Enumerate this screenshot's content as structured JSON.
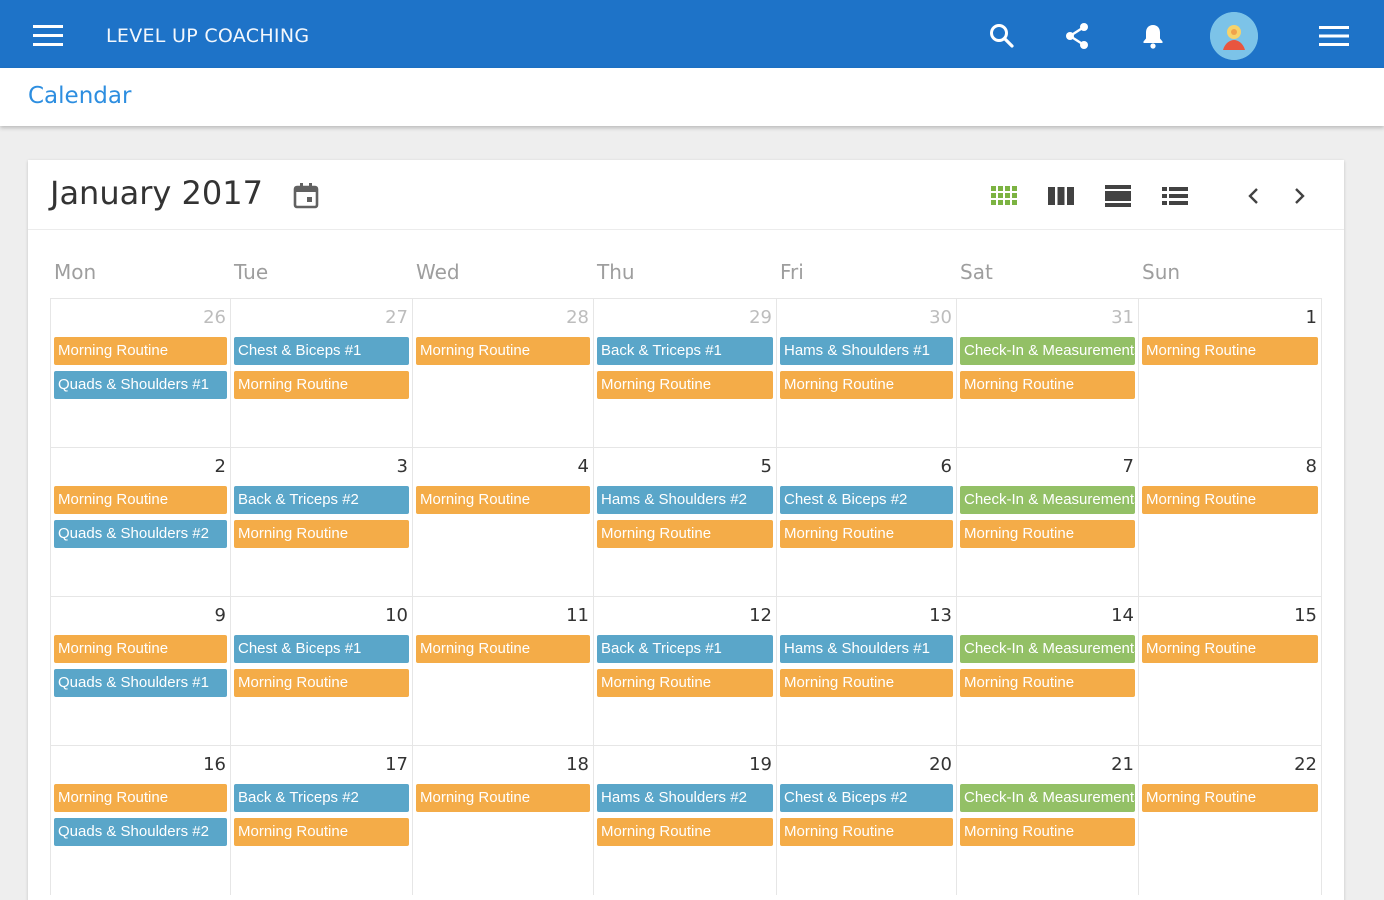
{
  "app": {
    "title": "LEVEL UP COACHING",
    "icons": [
      "menu-icon",
      "search-icon",
      "share-icon",
      "bell-icon",
      "avatar",
      "menu-icon"
    ]
  },
  "breadcrumb": {
    "label": "Calendar"
  },
  "calendar": {
    "month_title": "January 2017",
    "weekdays": [
      "Mon",
      "Tue",
      "Wed",
      "Thu",
      "Fri",
      "Sat",
      "Sun"
    ],
    "colors": {
      "routine": "#f4ac48",
      "workout": "#5aa6c9",
      "checkin": "#93c066",
      "accent": "#1e73c8",
      "active_view": "#7cb342"
    },
    "views": [
      "month-view-icon",
      "week-view-icon",
      "day-view-icon",
      "list-view-icon"
    ],
    "weeks": [
      {
        "days": [
          {
            "num": "26",
            "other": true,
            "events": [
              {
                "label": "Morning Routine",
                "type": "routine"
              },
              {
                "label": "Quads & Shoulders #1",
                "type": "workout"
              }
            ]
          },
          {
            "num": "27",
            "other": true,
            "events": [
              {
                "label": "Chest & Biceps #1",
                "type": "workout"
              },
              {
                "label": "Morning Routine",
                "type": "routine"
              }
            ]
          },
          {
            "num": "28",
            "other": true,
            "events": [
              {
                "label": "Morning Routine",
                "type": "routine"
              }
            ]
          },
          {
            "num": "29",
            "other": true,
            "events": [
              {
                "label": "Back & Triceps #1",
                "type": "workout"
              },
              {
                "label": "Morning Routine",
                "type": "routine"
              }
            ]
          },
          {
            "num": "30",
            "other": true,
            "events": [
              {
                "label": "Hams & Shoulders #1",
                "type": "workout"
              },
              {
                "label": "Morning Routine",
                "type": "routine"
              }
            ]
          },
          {
            "num": "31",
            "other": true,
            "events": [
              {
                "label": "Check-In & Measurements",
                "type": "checkin"
              },
              {
                "label": "Morning Routine",
                "type": "routine"
              }
            ]
          },
          {
            "num": "1",
            "other": false,
            "events": [
              {
                "label": "Morning Routine",
                "type": "routine"
              }
            ]
          }
        ]
      },
      {
        "days": [
          {
            "num": "2",
            "other": false,
            "events": [
              {
                "label": "Morning Routine",
                "type": "routine"
              },
              {
                "label": "Quads & Shoulders #2",
                "type": "workout"
              }
            ]
          },
          {
            "num": "3",
            "other": false,
            "events": [
              {
                "label": "Back & Triceps #2",
                "type": "workout"
              },
              {
                "label": "Morning Routine",
                "type": "routine"
              }
            ]
          },
          {
            "num": "4",
            "other": false,
            "events": [
              {
                "label": "Morning Routine",
                "type": "routine"
              }
            ]
          },
          {
            "num": "5",
            "other": false,
            "events": [
              {
                "label": "Hams & Shoulders #2",
                "type": "workout"
              },
              {
                "label": "Morning Routine",
                "type": "routine"
              }
            ]
          },
          {
            "num": "6",
            "other": false,
            "events": [
              {
                "label": "Chest & Biceps #2",
                "type": "workout"
              },
              {
                "label": "Morning Routine",
                "type": "routine"
              }
            ]
          },
          {
            "num": "7",
            "other": false,
            "events": [
              {
                "label": "Check-In & Measurements",
                "type": "checkin"
              },
              {
                "label": "Morning Routine",
                "type": "routine"
              }
            ]
          },
          {
            "num": "8",
            "other": false,
            "events": [
              {
                "label": "Morning Routine",
                "type": "routine"
              }
            ]
          }
        ]
      },
      {
        "days": [
          {
            "num": "9",
            "other": false,
            "events": [
              {
                "label": "Morning Routine",
                "type": "routine"
              },
              {
                "label": "Quads & Shoulders #1",
                "type": "workout"
              }
            ]
          },
          {
            "num": "10",
            "other": false,
            "events": [
              {
                "label": "Chest & Biceps #1",
                "type": "workout"
              },
              {
                "label": "Morning Routine",
                "type": "routine"
              }
            ]
          },
          {
            "num": "11",
            "other": false,
            "events": [
              {
                "label": "Morning Routine",
                "type": "routine"
              }
            ]
          },
          {
            "num": "12",
            "other": false,
            "events": [
              {
                "label": "Back & Triceps #1",
                "type": "workout"
              },
              {
                "label": "Morning Routine",
                "type": "routine"
              }
            ]
          },
          {
            "num": "13",
            "other": false,
            "events": [
              {
                "label": "Hams & Shoulders #1",
                "type": "workout"
              },
              {
                "label": "Morning Routine",
                "type": "routine"
              }
            ]
          },
          {
            "num": "14",
            "other": false,
            "events": [
              {
                "label": "Check-In & Measurements",
                "type": "checkin"
              },
              {
                "label": "Morning Routine",
                "type": "routine"
              }
            ]
          },
          {
            "num": "15",
            "other": false,
            "events": [
              {
                "label": "Morning Routine",
                "type": "routine"
              }
            ]
          }
        ]
      },
      {
        "days": [
          {
            "num": "16",
            "other": false,
            "events": [
              {
                "label": "Morning Routine",
                "type": "routine"
              },
              {
                "label": "Quads & Shoulders #2",
                "type": "workout"
              }
            ]
          },
          {
            "num": "17",
            "other": false,
            "events": [
              {
                "label": "Back & Triceps #2",
                "type": "workout"
              },
              {
                "label": "Morning Routine",
                "type": "routine"
              }
            ]
          },
          {
            "num": "18",
            "other": false,
            "events": [
              {
                "label": "Morning Routine",
                "type": "routine"
              }
            ]
          },
          {
            "num": "19",
            "other": false,
            "events": [
              {
                "label": "Hams & Shoulders #2",
                "type": "workout"
              },
              {
                "label": "Morning Routine",
                "type": "routine"
              }
            ]
          },
          {
            "num": "20",
            "other": false,
            "events": [
              {
                "label": "Chest & Biceps #2",
                "type": "workout"
              },
              {
                "label": "Morning Routine",
                "type": "routine"
              }
            ]
          },
          {
            "num": "21",
            "other": false,
            "events": [
              {
                "label": "Check-In & Measurements",
                "type": "checkin"
              },
              {
                "label": "Morning Routine",
                "type": "routine"
              }
            ]
          },
          {
            "num": "22",
            "other": false,
            "events": [
              {
                "label": "Morning Routine",
                "type": "routine"
              }
            ]
          }
        ]
      }
    ]
  }
}
